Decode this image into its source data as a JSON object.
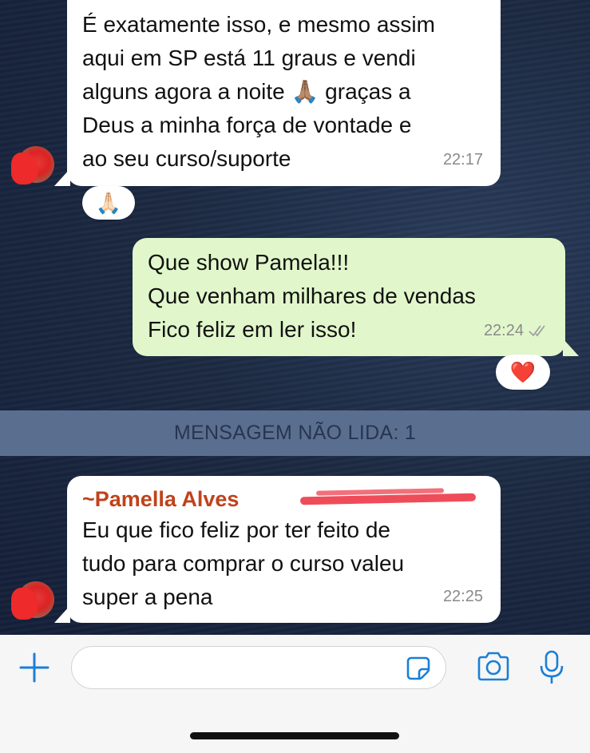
{
  "messages": [
    {
      "direction": "in",
      "text": "É exatamente isso, e mesmo assim\naqui em SP está 11 graus e vendi\nalguns agora a noite 🙏🏽 graças a\nDeus a minha força de vontade e\nao seu curso/suporte",
      "time": "22:17",
      "reaction": "🙏🏻"
    },
    {
      "direction": "out",
      "text": "Que show Pamela!!!\nQue venham milhares de vendas\nFico feliz em ler isso!",
      "time": "22:24",
      "status": "read",
      "reaction": "❤️"
    },
    {
      "direction": "in",
      "sender": "~Pamella Alves",
      "text": "Eu que fico feliz por ter feito de\ntudo para comprar o curso valeu\nsuper a pena",
      "time": "22:25"
    }
  ],
  "unread_banner": "MENSAGEM NÃO LIDA: 1",
  "input": {
    "placeholder": ""
  },
  "icons": {
    "add": "plus-icon",
    "sticker": "sticker-icon",
    "camera": "camera-icon",
    "mic": "microphone-icon"
  },
  "colors": {
    "accent": "#1a7fd6",
    "outgoing": "#e1f7cb",
    "incoming": "#ffffff",
    "sender": "#c0421a"
  }
}
